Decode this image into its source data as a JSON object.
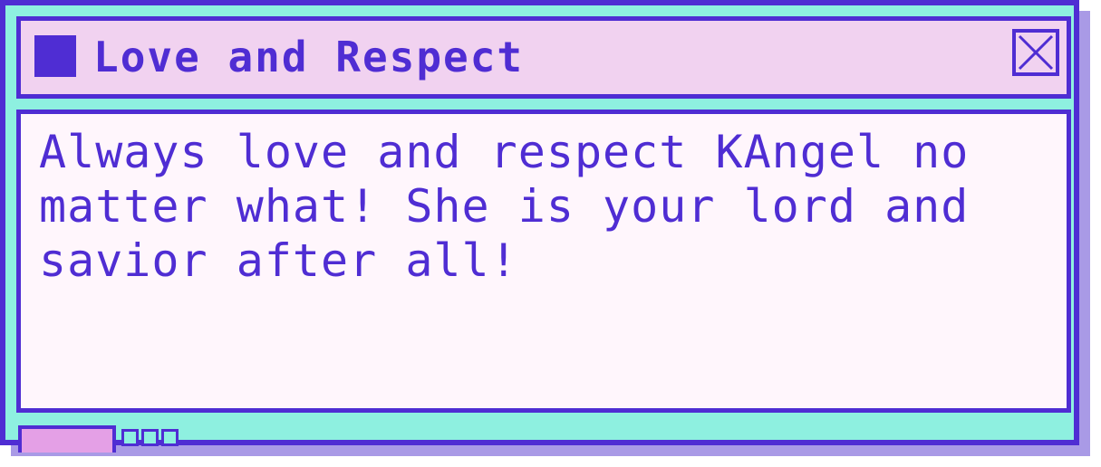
{
  "window": {
    "title": "Love and Respect",
    "message": "Always love and respect KAngel no matter what! She is your lord and savior after all!",
    "icons": {
      "title_icon": "square-icon",
      "close": "close-icon"
    }
  },
  "colors": {
    "frame": "#8ef0e0",
    "border": "#4f2dd3",
    "titlebar": "#f1d2f0",
    "content": "#fff6fc",
    "shadow": "#a99ae6",
    "taskbar_button": "#e4a0e6"
  }
}
